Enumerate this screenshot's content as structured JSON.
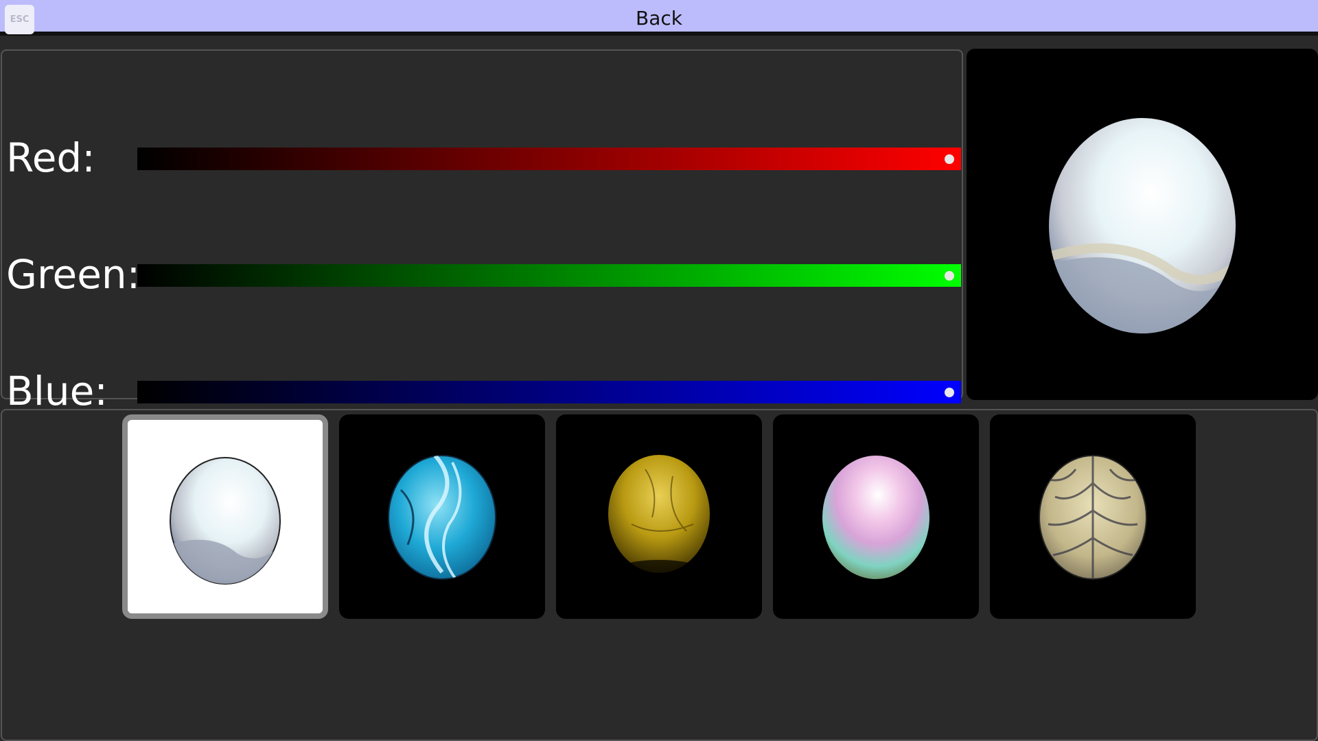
{
  "topbar": {
    "esc_label": "ESC",
    "back_label": "Back"
  },
  "sliders": [
    {
      "label": "Red:",
      "value": 1.0,
      "color": "#ff0000"
    },
    {
      "label": "Green:",
      "value": 1.0,
      "color": "#00ff00"
    },
    {
      "label": "Blue:",
      "value": 1.0,
      "color": "#0000ff"
    }
  ],
  "preview": {
    "material": "pearl"
  },
  "materials": [
    {
      "name": "pearl",
      "selected": true
    },
    {
      "name": "blue-marble",
      "selected": false
    },
    {
      "name": "gold",
      "selected": false
    },
    {
      "name": "iridescent",
      "selected": false
    },
    {
      "name": "wood",
      "selected": false
    }
  ]
}
